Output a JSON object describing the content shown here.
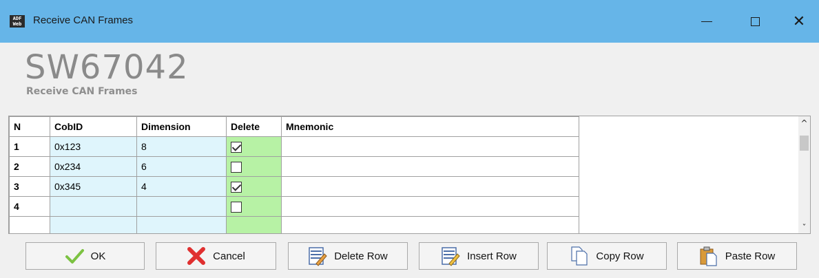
{
  "window": {
    "title": "Receive CAN Frames",
    "app_icon_line1": "ADF",
    "app_icon_line2": "Web"
  },
  "header": {
    "product_code": "SW67042",
    "subtitle": "Receive CAN Frames"
  },
  "grid": {
    "columns": [
      "N",
      "CobID",
      "Dimension",
      "Delete",
      "Mnemonic"
    ],
    "rows": [
      {
        "n": "1",
        "cobid": "0x123",
        "dimension": "8",
        "delete": true,
        "mnemonic": ""
      },
      {
        "n": "2",
        "cobid": "0x234",
        "dimension": "6",
        "delete": false,
        "mnemonic": ""
      },
      {
        "n": "3",
        "cobid": "0x345",
        "dimension": "4",
        "delete": true,
        "mnemonic": ""
      },
      {
        "n": "4",
        "cobid": "",
        "dimension": "",
        "delete": false,
        "mnemonic": ""
      }
    ]
  },
  "buttons": {
    "ok": "OK",
    "cancel": "Cancel",
    "delete_row": "Delete Row",
    "insert_row": "Insert Row",
    "copy_row": "Copy Row",
    "paste_row": "Paste Row"
  },
  "icons": {
    "ok": "checkmark-icon",
    "cancel": "red-x-icon",
    "delete_row": "delete-row-icon",
    "insert_row": "insert-row-icon",
    "copy_row": "copy-icon",
    "paste_row": "paste-icon"
  },
  "colors": {
    "titlebar": "#66b5e8",
    "cobid_dimension_cell": "#dff5fc",
    "delete_cell": "#b7f2a5",
    "ok_check": "#7cc242",
    "cancel_x": "#e03030"
  }
}
